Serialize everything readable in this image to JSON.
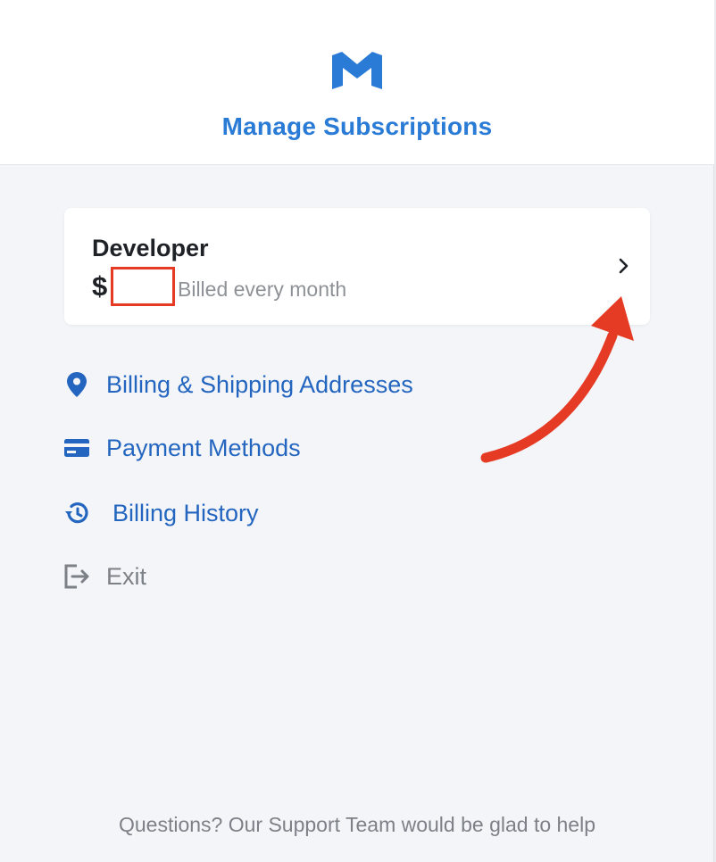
{
  "header": {
    "logo_icon": "brand-m-logo",
    "title": "Manage Subscriptions"
  },
  "plan": {
    "name": "Developer",
    "currency": "$",
    "price": "",
    "billing": "Billed every month",
    "chevron_icon": "chevron-right-icon"
  },
  "menu": [
    {
      "label": "Billing & Shipping Addresses",
      "icon": "location-pin-icon"
    },
    {
      "label": "Payment Methods",
      "icon": "credit-card-icon"
    },
    {
      "label": "Billing History",
      "icon": "history-icon"
    },
    {
      "label": "Exit",
      "icon": "exit-icon"
    }
  ],
  "footer": {
    "text": "Questions? Our Support Team would be glad to help"
  },
  "colors": {
    "brand_blue": "#2a7bd6",
    "link_blue": "#2466bf",
    "annotation_red": "#e53a23",
    "background": "#f3f5f9"
  }
}
